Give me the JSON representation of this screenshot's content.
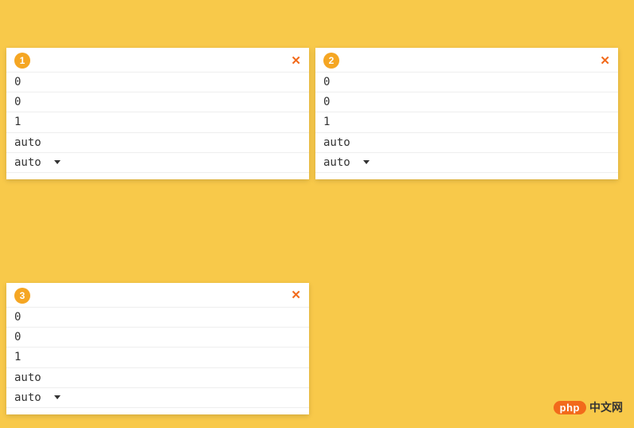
{
  "panels": [
    {
      "badge": "1",
      "rows": [
        "0",
        "0",
        "1",
        "auto",
        "auto"
      ],
      "hasDropdown": [
        false,
        false,
        false,
        false,
        true
      ]
    },
    {
      "badge": "2",
      "rows": [
        "0",
        "0",
        "1",
        "auto",
        "auto"
      ],
      "hasDropdown": [
        false,
        false,
        false,
        false,
        true
      ]
    },
    {
      "badge": "3",
      "rows": [
        "0",
        "0",
        "1",
        "auto",
        "auto"
      ],
      "hasDropdown": [
        false,
        false,
        false,
        false,
        true
      ]
    }
  ],
  "logo": {
    "pill": "php",
    "text": "中文网"
  }
}
